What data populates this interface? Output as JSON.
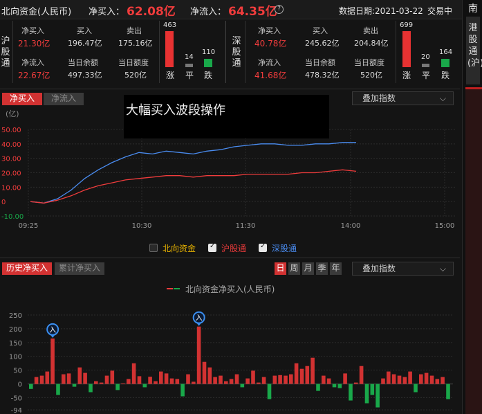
{
  "topbar": {
    "title": "北向资金(人民币)",
    "net_buy_label": "净买入：",
    "net_buy_value": "62.08亿",
    "net_inflow_label": "净流入：",
    "net_inflow_value": "64.35亿",
    "date_text": "数据日期:2021-03-22",
    "status": "交易中"
  },
  "sh": {
    "side": "沪股通",
    "net_buy_label": "净买入",
    "net_buy": "21.30亿",
    "buy_label": "买入",
    "buy": "196.47亿",
    "sell_label": "卖出",
    "sell": "175.16亿",
    "net_inflow_label": "净流入",
    "net_inflow": "22.67亿",
    "balance_label": "当日余额",
    "balance": "497.33亿",
    "quota_label": "当日额度",
    "quota": "520亿",
    "up": "463",
    "flat": "14",
    "down": "110",
    "up_label": "涨",
    "flat_label": "平",
    "down_label": "跌"
  },
  "sz": {
    "side": "深股通",
    "net_buy_label": "净买入",
    "net_buy": "40.78亿",
    "buy_label": "买入",
    "buy": "245.62亿",
    "sell_label": "卖出",
    "sell": "204.84亿",
    "net_inflow_label": "净流入",
    "net_inflow": "41.68亿",
    "balance_label": "当日余额",
    "balance": "478.32亿",
    "quota_label": "当日额度",
    "quota": "520亿",
    "up": "699",
    "flat": "20",
    "down": "164",
    "up_label": "涨",
    "flat_label": "平",
    "down_label": "跌"
  },
  "right_strip": {
    "south_label": "南",
    "hk_label": "港股通(沪)"
  },
  "intraday": {
    "tab_active": "净买入",
    "tab_inactive": "净流入",
    "overlay_label": "叠加指数",
    "banner": "大幅买入波段操作",
    "legend": [
      {
        "label": "北向资金",
        "checked": false,
        "color": "#e8b300"
      },
      {
        "label": "沪股通",
        "checked": true,
        "color": "#f03c3c"
      },
      {
        "label": "深股通",
        "checked": true,
        "color": "#4a8cf0"
      }
    ]
  },
  "history": {
    "tab_active": "历史净买入",
    "tab_inactive": "累计净买入",
    "periods": [
      "日",
      "周",
      "月",
      "季",
      "年"
    ],
    "active_period": "日",
    "overlay_label": "叠加指数",
    "legend_label": "北向资金净买入(人民币)",
    "marker_label": "入"
  },
  "chart_data": [
    {
      "type": "line",
      "ylabel": "(亿)",
      "ylim": [
        -10,
        50
      ],
      "yticks": [
        "50.00",
        "40.00",
        "30.00",
        "20.00",
        "10.00",
        "0",
        "-10.00"
      ],
      "xticks": [
        "09:25",
        "10:30",
        "11:30",
        "14:00",
        "15:00"
      ],
      "series": [
        {
          "name": "深股通",
          "color": "#4a8cf0",
          "values": [
            0,
            -1,
            2,
            8,
            16,
            22,
            27,
            31,
            34,
            33,
            35,
            34,
            33,
            35,
            36,
            38,
            39,
            40,
            40,
            39,
            39,
            40,
            40,
            41,
            41
          ]
        },
        {
          "name": "沪股通",
          "color": "#f03c3c",
          "values": [
            0,
            -1,
            1,
            4,
            8,
            11,
            13,
            15,
            16,
            17,
            18,
            18,
            17,
            18,
            18,
            18,
            19,
            19,
            19,
            19,
            20,
            20,
            21,
            22,
            21
          ]
        }
      ],
      "grid": true
    },
    {
      "type": "bar",
      "ylim": [
        -94,
        250
      ],
      "yticks": [
        "250",
        "200",
        "150",
        "100",
        "50",
        "0",
        "-50",
        "-94"
      ],
      "values": [
        -18,
        25,
        30,
        45,
        165,
        -40,
        35,
        38,
        -10,
        60,
        40,
        -30,
        10,
        5,
        30,
        48,
        -22,
        2,
        18,
        75,
        28,
        -12,
        26,
        10,
        45,
        38,
        20,
        18,
        -45,
        35,
        8,
        208,
        80,
        60,
        25,
        30,
        10,
        18,
        35,
        -12,
        20,
        48,
        5,
        25,
        -55,
        30,
        32,
        30,
        35,
        75,
        55,
        65,
        95,
        -25,
        30,
        20,
        -12,
        -15,
        38,
        -60,
        5,
        65,
        -70,
        -40,
        -85,
        20,
        45,
        35,
        30,
        25,
        45,
        -30,
        35,
        40,
        30,
        18,
        25,
        -55
      ],
      "markers": [
        4,
        31
      ]
    }
  ]
}
